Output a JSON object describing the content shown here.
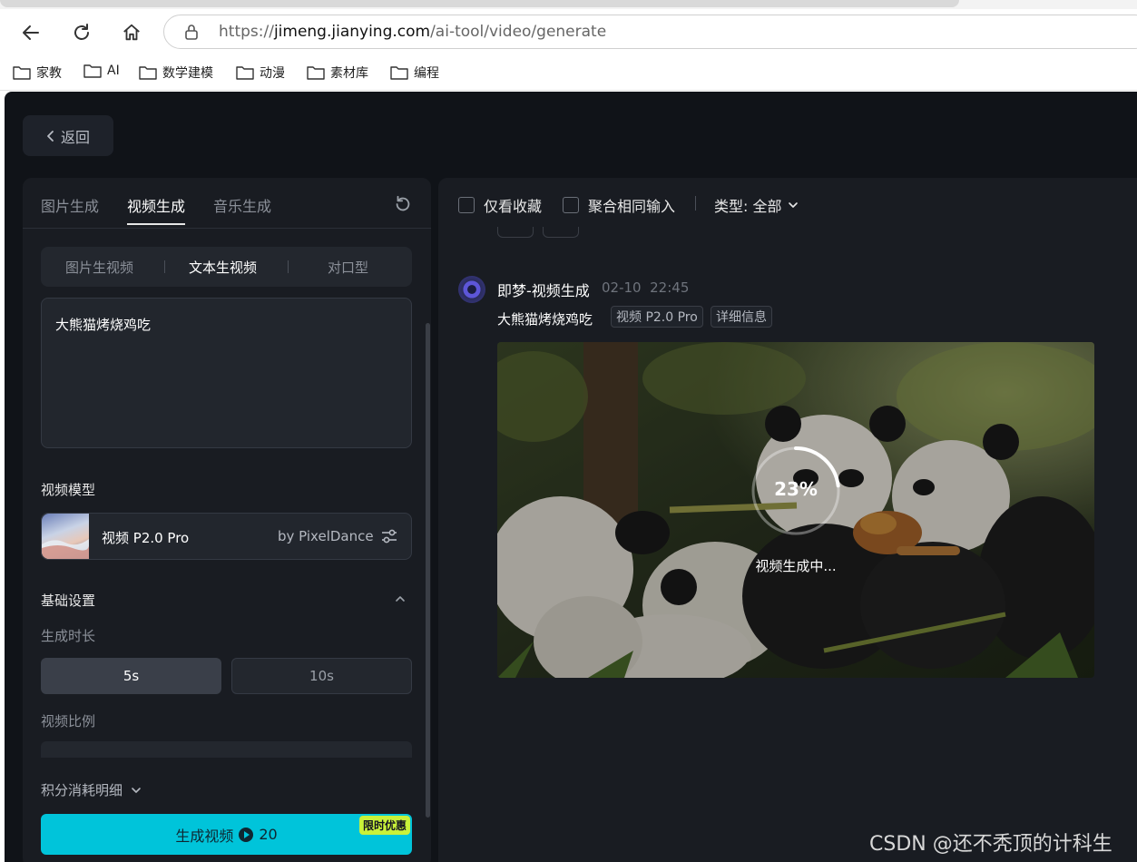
{
  "browser": {
    "url_scheme": "https://",
    "url_host": "jimeng.jianying.com",
    "url_path": "/ai-tool/video/generate",
    "bookmarks": [
      {
        "label": "家教"
      },
      {
        "label": "AI"
      },
      {
        "label": "数学建模"
      },
      {
        "label": "动漫"
      },
      {
        "label": "素材库"
      },
      {
        "label": "编程"
      }
    ]
  },
  "app": {
    "back_label": "返回",
    "main_tabs": [
      {
        "label": "图片生成"
      },
      {
        "label": "视频生成",
        "active": true
      },
      {
        "label": "音乐生成"
      }
    ],
    "sub_tabs": [
      {
        "label": "图片生视频"
      },
      {
        "label": "文本生视频",
        "active": true
      },
      {
        "label": "对口型"
      }
    ],
    "prompt": "大熊猫烤烧鸡吃",
    "model_section_title": "视频模型",
    "model": {
      "name": "视频 P2.0 Pro",
      "by": "by PixelDance"
    },
    "basic_settings": "基础设置",
    "duration_label": "生成时长",
    "durations": [
      {
        "label": "5s",
        "selected": true
      },
      {
        "label": "10s",
        "selected": false
      }
    ],
    "ratio_label": "视频比例",
    "points_label": "积分消耗明细",
    "generate": {
      "label": "生成视频",
      "cost": "20",
      "promo": "限时优惠",
      "color": "#00c4da"
    }
  },
  "results": {
    "filters": {
      "favorites_only": "仅看收藏",
      "merge_same_input": "聚合相同输入",
      "type_label": "类型: 全部"
    },
    "entry": {
      "title": "即梦-视频生成",
      "date": "02-10",
      "time": "22:45",
      "prompt": "大熊猫烤烧鸡吃",
      "model_tag": "视频 P2.0 Pro",
      "detail_tag": "详细信息",
      "progress_percent": 23,
      "progress_text": "23%",
      "status": "视频生成中..."
    }
  },
  "watermark": "CSDN @还不秃顶的计科生"
}
